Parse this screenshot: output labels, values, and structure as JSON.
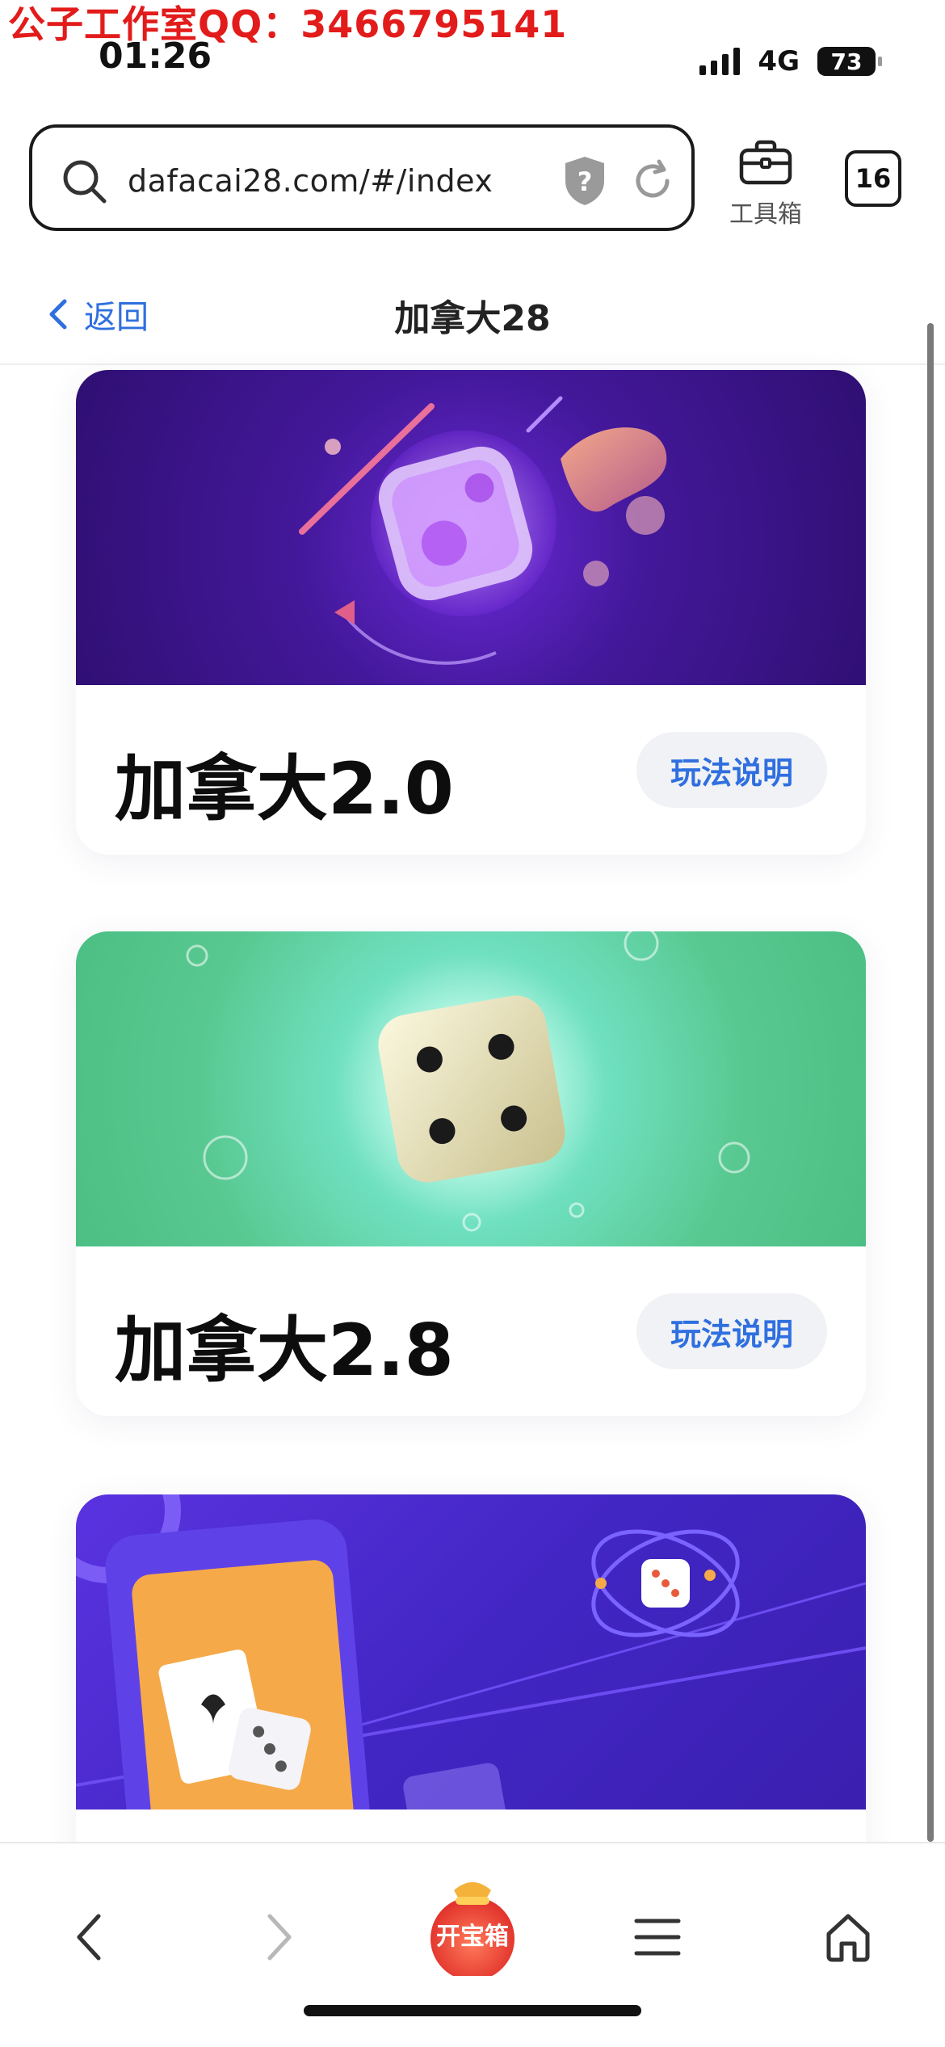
{
  "watermark": "公子工作室QQ：3466795141",
  "status": {
    "time": "01:26",
    "network": "4G",
    "battery": "73"
  },
  "browser": {
    "url": "dafacai28.com/#/index",
    "toolbox_label": "工具箱",
    "tab_count": "16"
  },
  "page": {
    "back_label": "返回",
    "title": "加拿大28"
  },
  "cards": [
    {
      "title": "加拿大2.0",
      "button": "玩法说明"
    },
    {
      "title": "加拿大2.8",
      "button": "玩法说明"
    },
    {
      "title": "",
      "button": ""
    }
  ],
  "bottom_nav": {
    "treasure_label": "开宝箱"
  },
  "colors": {
    "accent": "#2f6fdf",
    "card1_bg": "#3a1585",
    "card2_bg": "#5cc88f",
    "card3_bg": "#4b27c9"
  }
}
